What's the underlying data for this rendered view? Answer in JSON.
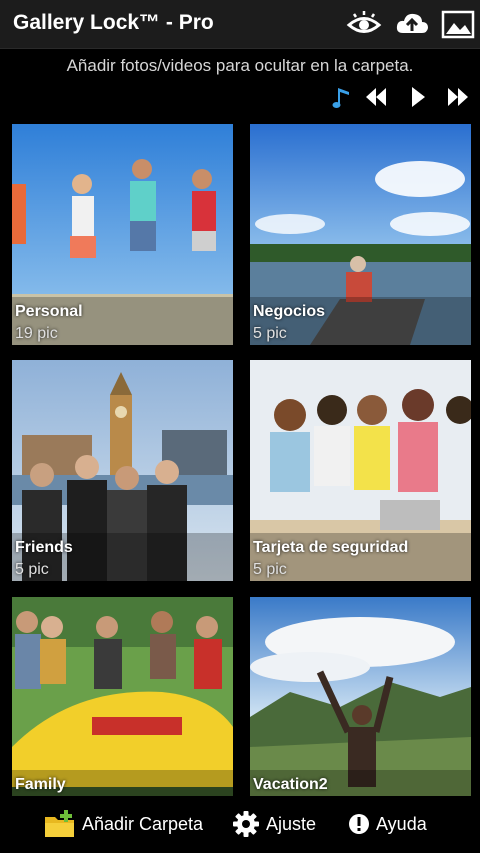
{
  "app": {
    "title": "Gallery Lock™ - Pro",
    "subtitle": "Añadir fotos/videos para ocultar en la carpeta."
  },
  "toolbar_icons": [
    "eye-icon",
    "cloud-upload-icon",
    "image-icon"
  ],
  "player_icons": [
    "music-note-icon",
    "rewind-icon",
    "play-icon",
    "fast-forward-icon"
  ],
  "colors": {
    "accent_blue": "#3aa0e8",
    "background": "#000000",
    "appbar": "#1c1c1c"
  },
  "folders": [
    {
      "name": "Personal",
      "count": "19 pic"
    },
    {
      "name": "Negocios",
      "count": "5 pic"
    },
    {
      "name": "Friends",
      "count": "5 pic"
    },
    {
      "name": "Tarjeta de seguridad",
      "count": "5 pic"
    },
    {
      "name": "Family",
      "count": ""
    },
    {
      "name": "Vacation2",
      "count": ""
    }
  ],
  "bottom_bar": {
    "add_folder": "Añadir Carpeta",
    "settings": "Ajuste",
    "help": "Ayuda"
  }
}
